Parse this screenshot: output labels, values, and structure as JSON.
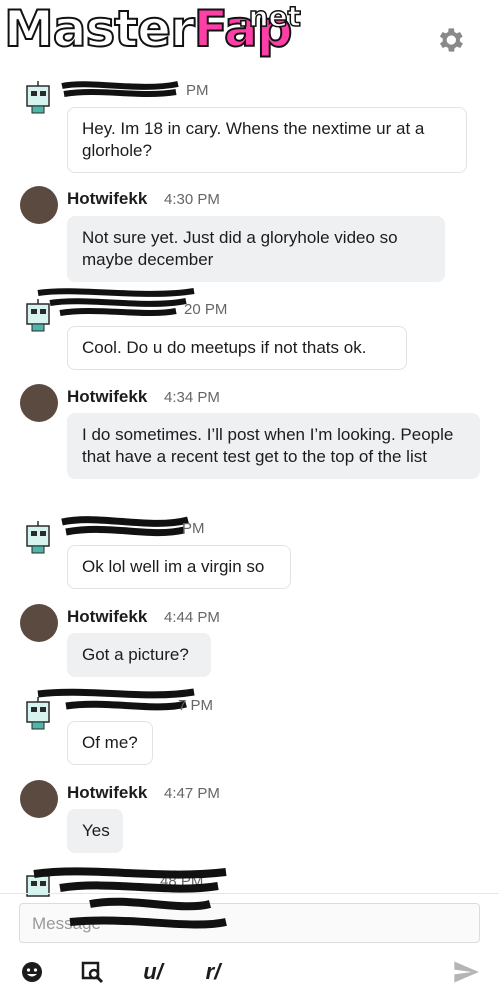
{
  "header": {
    "watermark_part1": "Master",
    "watermark_part2": "Fap",
    "watermark_tld": ".net",
    "settings_icon": "gear-icon"
  },
  "messages": [
    {
      "sender": "",
      "time": "PM",
      "text": "Hey. Im 18 in cary. Whens the nextime ur at a glorhole?",
      "side": "them"
    },
    {
      "sender": "Hotwifekk",
      "time": "4:30 PM",
      "text": "Not sure yet. Just did a gloryhole video so maybe december",
      "side": "me"
    },
    {
      "sender": "",
      "time": "20 PM",
      "text": "Cool. Do u do meetups if not thats ok.",
      "side": "them"
    },
    {
      "sender": "Hotwifekk",
      "time": "4:34 PM",
      "text": "I do sometimes. I’ll post when I’m looking. People that have a recent test get to the top of the list",
      "side": "me"
    },
    {
      "sender": "",
      "time": "PM",
      "text": "Ok lol well im a virgin so",
      "side": "them"
    },
    {
      "sender": "Hotwifekk",
      "time": "4:44 PM",
      "text": "Got a picture?",
      "side": "me"
    },
    {
      "sender": "",
      "time": "7 PM",
      "text": "Of me?",
      "side": "them"
    },
    {
      "sender": "Hotwifekk",
      "time": "4:47 PM",
      "text": "Yes",
      "side": "me"
    },
    {
      "sender": "",
      "time": "48 PM",
      "text": "",
      "side": "them"
    }
  ],
  "compose": {
    "placeholder": "Message",
    "toolbar": {
      "emoji_icon": "emoji-icon",
      "gif_icon": "image-search-icon",
      "user_label": "u/",
      "subreddit_label": "r/",
      "send_icon": "send-icon"
    }
  },
  "colors": {
    "bubble_me": "#eef0f2",
    "bubble_them": "#ffffff",
    "watermark_pink": "#ff3fa7"
  }
}
